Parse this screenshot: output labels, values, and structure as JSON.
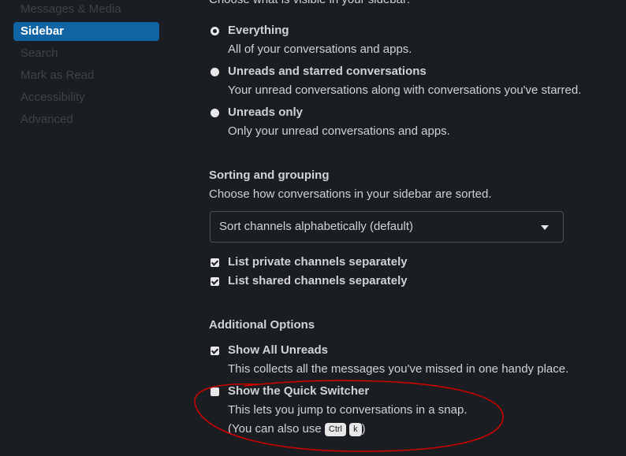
{
  "sidebar": {
    "items": [
      {
        "label": "Messages & Media"
      },
      {
        "label": "Sidebar"
      },
      {
        "label": "Search"
      },
      {
        "label": "Mark as Read"
      },
      {
        "label": "Accessibility"
      },
      {
        "label": "Advanced"
      }
    ],
    "active_index": 1
  },
  "visibility": {
    "intro": "Choose what is visible in your sidebar:",
    "options": [
      {
        "label": "Everything",
        "desc": "All of your conversations and apps.",
        "selected": true
      },
      {
        "label": "Unreads and starred conversations",
        "desc": "Your unread conversations along with conversations you've starred.",
        "selected": false
      },
      {
        "label": "Unreads only",
        "desc": "Only your unread conversations and apps.",
        "selected": false
      }
    ]
  },
  "sorting": {
    "title": "Sorting and grouping",
    "desc": "Choose how conversations in your sidebar are sorted.",
    "select_value": "Sort channels alphabetically (default)",
    "checkboxes": [
      {
        "label": "List private channels separately",
        "checked": true
      },
      {
        "label": "List shared channels separately",
        "checked": true
      }
    ]
  },
  "additional": {
    "title": "Additional Options",
    "show_all_unreads": {
      "label": "Show All Unreads",
      "desc": "This collects all the messages you've missed in one handy place.",
      "checked": true
    },
    "quick_switcher": {
      "label": "Show the Quick Switcher",
      "desc": "This lets you jump to conversations in a snap.",
      "shortcut_prefix": "(You can also use",
      "key1": "Ctrl",
      "key2": "k",
      "shortcut_suffix": ")",
      "checked": false
    }
  },
  "colors": {
    "background": "#1a1d21",
    "active_nav": "#1164a3",
    "annotation": "#cc0000"
  }
}
